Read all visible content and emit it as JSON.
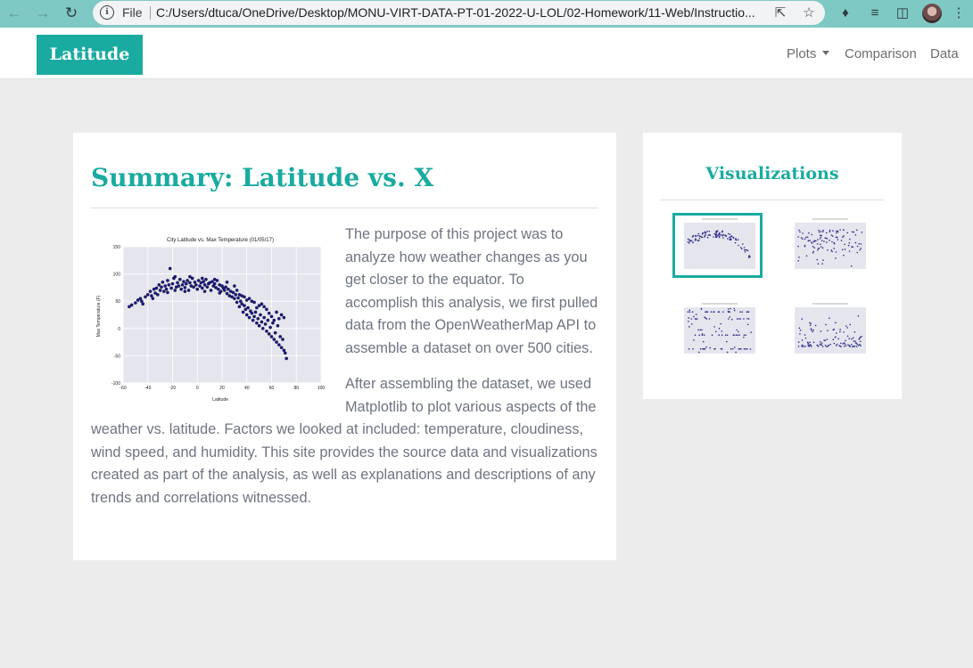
{
  "browser": {
    "scheme_label": "File",
    "url": "C:/Users/dtuca/OneDrive/Desktop/MONU-VIRT-DATA-PT-01-2022-U-LOL/02-Homework/11-Web/Instructio...",
    "icons": [
      "back-arrow-icon",
      "forward-arrow-icon",
      "reload-icon",
      "info-icon",
      "share-icon",
      "star-icon",
      "extensions-icon",
      "reading-list-icon",
      "side-panel-icon",
      "profile-avatar",
      "more-menu-icon"
    ]
  },
  "navbar": {
    "brand": "Latitude",
    "links": {
      "plots": "Plots",
      "comparison": "Comparison",
      "data": "Data"
    },
    "brand_color": "#1aaba0"
  },
  "summary": {
    "title": "Summary: Latitude vs. X",
    "paragraph1": "The purpose of this project was to analyze how weather changes as you get closer to the equator. To accomplish this analysis, we first pulled data from the OpenWeatherMap API to assemble a dataset on over 500 cities.",
    "paragraph2": "After assembling the dataset, we used Matplotlib to plot various aspects of the weather vs. latitude. Factors we looked at included: temperature, cloudiness, wind speed, and humidity. This site provides the source data and visualizations created as part of the analysis, as well as explanations and descriptions of any trends and correlations witnessed."
  },
  "visualizations": {
    "title": "Visualizations",
    "thumbnails": [
      {
        "name": "max-temperature",
        "active": true
      },
      {
        "name": "humidity",
        "active": false
      },
      {
        "name": "cloudiness",
        "active": false
      },
      {
        "name": "wind-speed",
        "active": false
      }
    ]
  },
  "chart_data": {
    "type": "scatter",
    "title": "City Latitude vs. Max Temperature (01/05/17)",
    "xlabel": "Latitude",
    "ylabel": "Max Temperature (F)",
    "xlim": [
      -60,
      100
    ],
    "ylim": [
      -100,
      150
    ],
    "xticks": [
      -60,
      -40,
      -20,
      0,
      20,
      40,
      60,
      80,
      100
    ],
    "yticks": [
      -100,
      -50,
      0,
      50,
      100,
      150
    ],
    "grid": true,
    "marker_color": "#1a1a7a",
    "points": [
      [
        -55,
        40
      ],
      [
        -53,
        43
      ],
      [
        -50,
        47
      ],
      [
        -48,
        52
      ],
      [
        -46,
        55
      ],
      [
        -45,
        50
      ],
      [
        -42,
        58
      ],
      [
        -40,
        62
      ],
      [
        -38,
        68
      ],
      [
        -37,
        60
      ],
      [
        -35,
        72
      ],
      [
        -34,
        65
      ],
      [
        -33,
        74
      ],
      [
        -31,
        80
      ],
      [
        -30,
        70
      ],
      [
        -29,
        76
      ],
      [
        -28,
        85
      ],
      [
        -27,
        68
      ],
      [
        -26,
        78
      ],
      [
        -25,
        72
      ],
      [
        -24,
        88
      ],
      [
        -23,
        80
      ],
      [
        -22,
        110
      ],
      [
        -21,
        74
      ],
      [
        -20,
        82
      ],
      [
        -19,
        92
      ],
      [
        -18,
        70
      ],
      [
        -17,
        76
      ],
      [
        -16,
        84
      ],
      [
        -15,
        78
      ],
      [
        -14,
        90
      ],
      [
        -13,
        72
      ],
      [
        -12,
        80
      ],
      [
        -11,
        86
      ],
      [
        -10,
        75
      ],
      [
        -9,
        82
      ],
      [
        -8,
        88
      ],
      [
        -7,
        70
      ],
      [
        -6,
        84
      ],
      [
        -5,
        78
      ],
      [
        -4,
        92
      ],
      [
        -3,
        76
      ],
      [
        -2,
        85
      ],
      [
        -1,
        80
      ],
      [
        0,
        72
      ],
      [
        1,
        88
      ],
      [
        2,
        78
      ],
      [
        3,
        84
      ],
      [
        4,
        74
      ],
      [
        5,
        86
      ],
      [
        6,
        80
      ],
      [
        7,
        90
      ],
      [
        8,
        76
      ],
      [
        9,
        82
      ],
      [
        10,
        84
      ],
      [
        11,
        70
      ],
      [
        12,
        86
      ],
      [
        13,
        78
      ],
      [
        14,
        82
      ],
      [
        15,
        75
      ],
      [
        16,
        88
      ],
      [
        17,
        72
      ],
      [
        18,
        80
      ],
      [
        19,
        68
      ],
      [
        20,
        78
      ],
      [
        21,
        74
      ],
      [
        22,
        70
      ],
      [
        23,
        76
      ],
      [
        24,
        64
      ],
      [
        25,
        72
      ],
      [
        26,
        60
      ],
      [
        27,
        68
      ],
      [
        28,
        58
      ],
      [
        29,
        66
      ],
      [
        30,
        55
      ],
      [
        31,
        62
      ],
      [
        32,
        48
      ],
      [
        33,
        56
      ],
      [
        34,
        40
      ],
      [
        35,
        50
      ],
      [
        36,
        45
      ],
      [
        37,
        30
      ],
      [
        38,
        42
      ],
      [
        39,
        35
      ],
      [
        40,
        25
      ],
      [
        41,
        38
      ],
      [
        42,
        20
      ],
      [
        43,
        32
      ],
      [
        44,
        28
      ],
      [
        45,
        15
      ],
      [
        46,
        22
      ],
      [
        47,
        30
      ],
      [
        48,
        10
      ],
      [
        49,
        18
      ],
      [
        50,
        5
      ],
      [
        51,
        25
      ],
      [
        52,
        12
      ],
      [
        53,
        0
      ],
      [
        54,
        20
      ],
      [
        55,
        8
      ],
      [
        56,
        -5
      ],
      [
        57,
        15
      ],
      [
        58,
        -10
      ],
      [
        59,
        2
      ],
      [
        60,
        -15
      ],
      [
        61,
        10
      ],
      [
        62,
        -20
      ],
      [
        63,
        -8
      ],
      [
        64,
        -25
      ],
      [
        65,
        5
      ],
      [
        66,
        -30
      ],
      [
        67,
        -15
      ],
      [
        68,
        -35
      ],
      [
        69,
        -20
      ],
      [
        70,
        -40
      ],
      [
        71,
        -45
      ],
      [
        72,
        -55
      ],
      [
        70,
        20
      ],
      [
        68,
        25
      ],
      [
        66,
        18
      ],
      [
        64,
        30
      ],
      [
        62,
        15
      ],
      [
        60,
        22
      ],
      [
        58,
        28
      ],
      [
        56,
        35
      ],
      [
        54,
        40
      ],
      [
        52,
        45
      ],
      [
        50,
        42
      ],
      [
        48,
        38
      ],
      [
        46,
        48
      ],
      [
        44,
        50
      ],
      [
        42,
        55
      ],
      [
        40,
        52
      ],
      [
        38,
        58
      ],
      [
        36,
        60
      ],
      [
        34,
        62
      ],
      [
        -44,
        45
      ],
      [
        -36,
        55
      ],
      [
        -32,
        62
      ],
      [
        -18,
        95
      ],
      [
        -6,
        95
      ],
      [
        4,
        92
      ],
      [
        14,
        90
      ],
      [
        24,
        85
      ],
      [
        30,
        78
      ],
      [
        32,
        70
      ],
      [
        -24,
        66
      ],
      [
        -10,
        68
      ],
      [
        6,
        68
      ],
      [
        18,
        65
      ]
    ]
  }
}
